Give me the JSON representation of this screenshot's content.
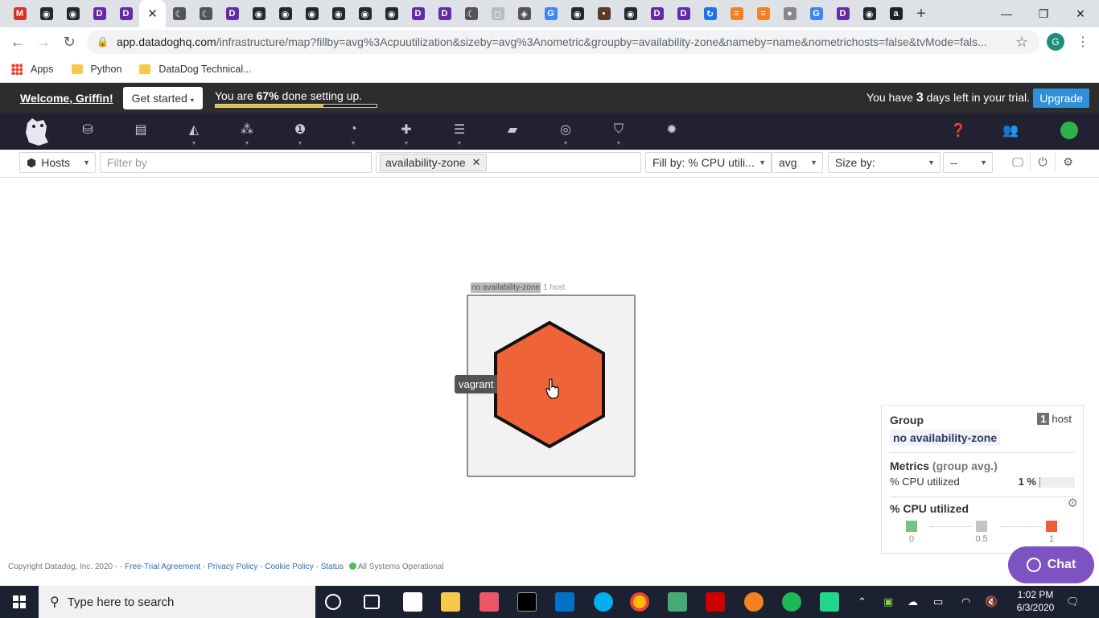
{
  "browser": {
    "tabs": [
      {
        "icon": "gmail-icon",
        "color": "#d93025",
        "glyph": "M"
      },
      {
        "icon": "github-icon",
        "color": "#24292e",
        "glyph": "◉"
      },
      {
        "icon": "github-icon",
        "color": "#24292e",
        "glyph": "◉"
      },
      {
        "icon": "datadog-icon",
        "color": "#632ca6",
        "glyph": "D"
      },
      {
        "icon": "datadog-icon",
        "color": "#632ca6",
        "glyph": "D"
      },
      {
        "icon": "close-icon",
        "active": true,
        "glyph": "✕"
      },
      {
        "icon": "page-icon",
        "color": "#555",
        "glyph": "☾"
      },
      {
        "icon": "page-icon",
        "color": "#555",
        "glyph": "☾"
      },
      {
        "icon": "datadog-icon",
        "color": "#632ca6",
        "glyph": "D"
      },
      {
        "icon": "github-icon",
        "color": "#24292e",
        "glyph": "◉"
      },
      {
        "icon": "github-icon",
        "color": "#24292e",
        "glyph": "◉"
      },
      {
        "icon": "github-icon",
        "color": "#24292e",
        "glyph": "◉"
      },
      {
        "icon": "github-icon",
        "color": "#24292e",
        "glyph": "◉"
      },
      {
        "icon": "github-icon",
        "color": "#24292e",
        "glyph": "◉"
      },
      {
        "icon": "github-icon",
        "color": "#24292e",
        "glyph": "◉"
      },
      {
        "icon": "datadog-icon",
        "color": "#632ca6",
        "glyph": "D"
      },
      {
        "icon": "datadog-icon",
        "color": "#632ca6",
        "glyph": "D"
      },
      {
        "icon": "page-icon",
        "color": "#555",
        "glyph": "☾"
      },
      {
        "icon": "page-icon",
        "color": "#bbb",
        "glyph": "◻"
      },
      {
        "icon": "page-icon",
        "color": "#555",
        "glyph": "◈"
      },
      {
        "icon": "google-icon",
        "color": "#4285f4",
        "glyph": "G"
      },
      {
        "icon": "github-icon",
        "color": "#24292e",
        "glyph": "◉"
      },
      {
        "icon": "avatar-icon",
        "color": "#5a3a2a",
        "glyph": "▪"
      },
      {
        "icon": "github-icon",
        "color": "#24292e",
        "glyph": "◉"
      },
      {
        "icon": "datadog-icon",
        "color": "#632ca6",
        "glyph": "D"
      },
      {
        "icon": "datadog-icon",
        "color": "#632ca6",
        "glyph": "D"
      },
      {
        "icon": "page-icon",
        "color": "#1a73e8",
        "glyph": "↻"
      },
      {
        "icon": "stackoverflow-icon",
        "color": "#f48024",
        "glyph": "≡"
      },
      {
        "icon": "stackoverflow-icon",
        "color": "#f48024",
        "glyph": "≡"
      },
      {
        "icon": "page-icon",
        "color": "#888",
        "glyph": "●"
      },
      {
        "icon": "google-icon",
        "color": "#4285f4",
        "glyph": "G"
      },
      {
        "icon": "datadog-icon",
        "color": "#632ca6",
        "glyph": "D"
      },
      {
        "icon": "github-icon",
        "color": "#24292e",
        "glyph": "◉"
      },
      {
        "icon": "amazon-icon",
        "color": "#222",
        "glyph": "a"
      }
    ],
    "new_tab": "+",
    "url_host": "app.datadoghq.com",
    "url_rest": "/infrastructure/map?fillby=avg%3Acpuutilization&sizeby=avg%3Anometric&groupby=availability-zone&nameby=name&nometrichosts=false&tvMode=fals...",
    "profile_letter": "G",
    "bookmarks": [
      "Apps",
      "Python",
      "DataDog Technical..."
    ]
  },
  "banner": {
    "welcome": "Welcome, Griffin!",
    "get_started": "Get started",
    "setup_prefix": "You are ",
    "setup_pct": "67%",
    "setup_suffix": " done setting up.",
    "setup_progress": 0.67,
    "trial_prefix": "You have ",
    "trial_days": "3",
    "trial_suffix": " days left in your trial.",
    "upgrade": "Upgrade"
  },
  "toolbar": {
    "hosts": "Hosts",
    "filter_placeholder": "Filter by",
    "group_chip": "availability-zone",
    "fill_by": "Fill by: % CPU utili...",
    "fill_agg": "avg",
    "size_by": "Size by:",
    "size_agg": "--"
  },
  "map": {
    "group_tag": "no availability-zone",
    "group_count": "1 host",
    "host_name": "vagrant",
    "host_color": "#ef6339"
  },
  "panel": {
    "group_title": "Group",
    "host_num": "1",
    "host_word": "host",
    "group_value": "no availability-zone",
    "metrics_title": "Metrics",
    "metrics_sub": "(group avg.)",
    "metric_name": "% CPU utilized",
    "metric_value": "1 %",
    "metric_fraction": 0.01,
    "legend_title": "% CPU utilized",
    "legend": [
      {
        "label": "0",
        "color": "#73c386"
      },
      {
        "label": "0.5",
        "color": "#c4c4c4"
      },
      {
        "label": "1",
        "color": "#f15b3a"
      }
    ]
  },
  "footer": {
    "copyright": "Copyright Datadog, Inc. 2020 - -",
    "link1": "Free-Trial Agreement",
    "link2": "Privacy Policy",
    "link3": "Cookie Policy",
    "link4": "Status",
    "status": "All Systems Operational"
  },
  "chat": "Chat",
  "taskbar": {
    "search_placeholder": "Type here to search",
    "time": "1:02 PM",
    "date": "6/3/2020"
  }
}
